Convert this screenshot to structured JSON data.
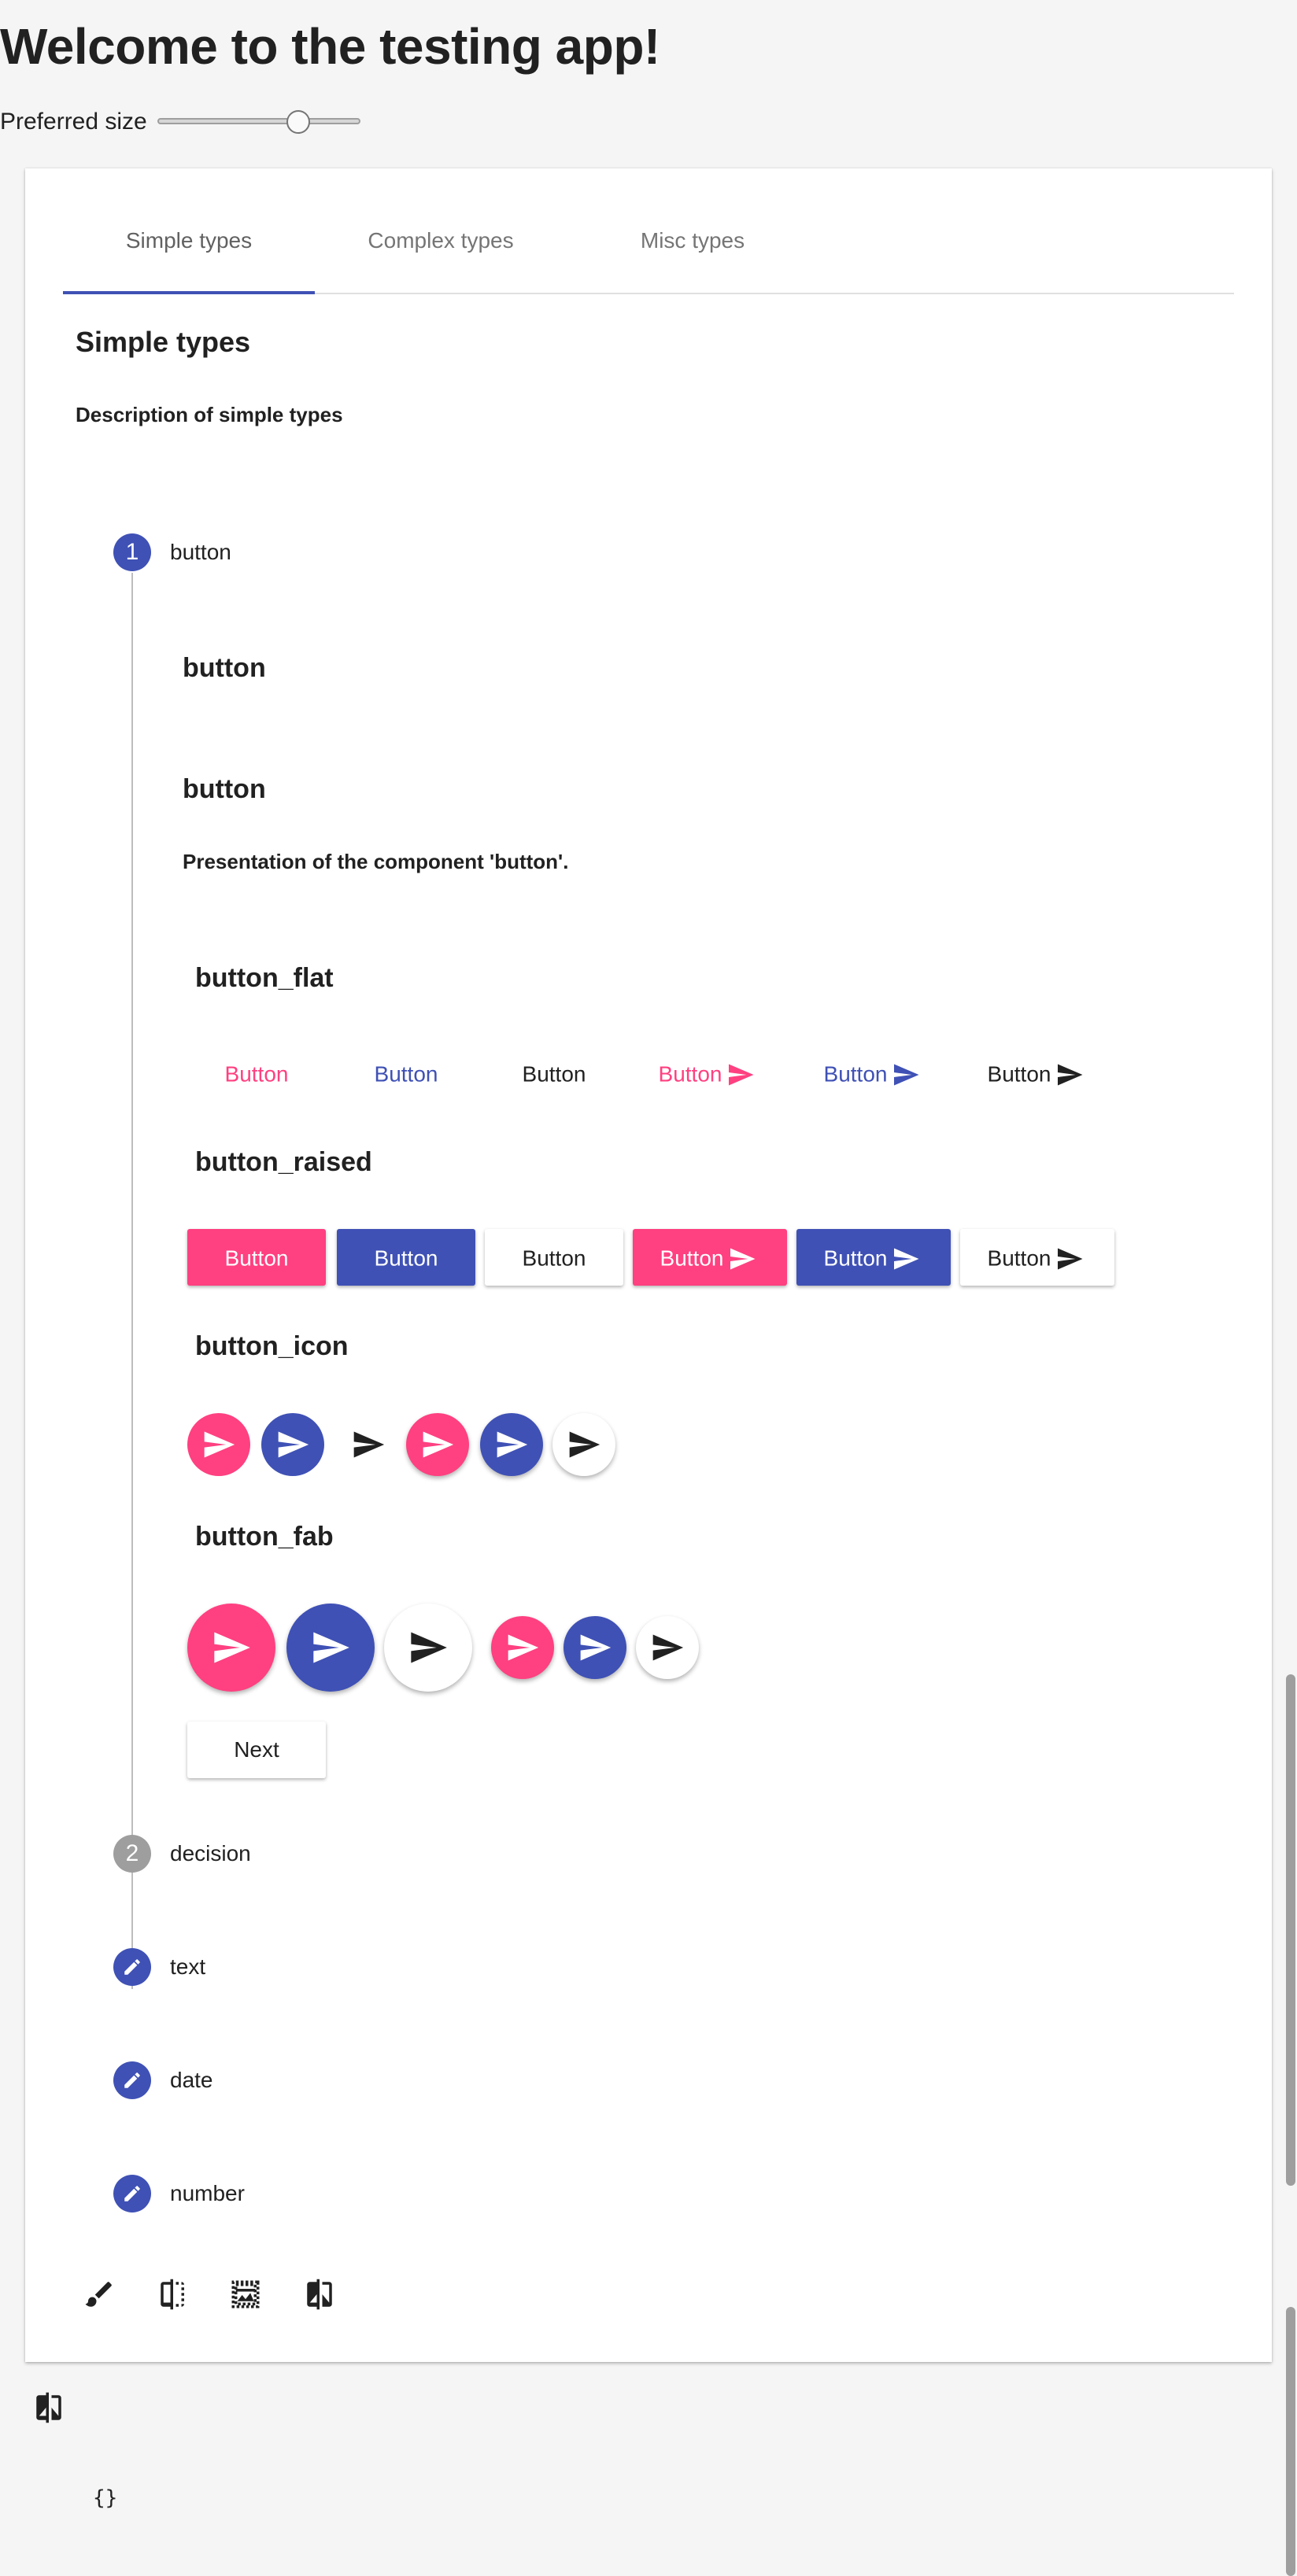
{
  "page": {
    "title": "Welcome to the testing app!",
    "preferred_size_label": "Preferred size",
    "preferred_size_value": 0.72
  },
  "tabs": [
    {
      "label": "Simple types",
      "active": true
    },
    {
      "label": "Complex types",
      "active": false
    },
    {
      "label": "Misc types",
      "active": false
    }
  ],
  "section": {
    "title": "Simple types",
    "description": "Description of simple types"
  },
  "steps": [
    {
      "indicator": "1",
      "label": "button"
    },
    {
      "indicator": "2",
      "label": "decision"
    },
    {
      "indicator": "pencil-icon",
      "label": "text"
    },
    {
      "indicator": "pencil-icon",
      "label": "date"
    },
    {
      "indicator": "pencil-icon",
      "label": "number"
    }
  ],
  "step1": {
    "heading": "button",
    "subheading": "button",
    "presentation": "Presentation of the component 'button'.",
    "groups": {
      "flat": "button_flat",
      "raised": "button_raised",
      "icon": "button_icon",
      "fab": "button_fab"
    },
    "button_label": "Button",
    "next_label": "Next"
  },
  "colors": {
    "primary": "#3f51b5",
    "accent": "#ff4081",
    "text": "#212121"
  },
  "toolbar": [
    "brush-icon",
    "compare-split-icon",
    "image-aspect-icon",
    "compare-icon"
  ],
  "bottom_icon": "compare-icon",
  "json_output": "{}"
}
